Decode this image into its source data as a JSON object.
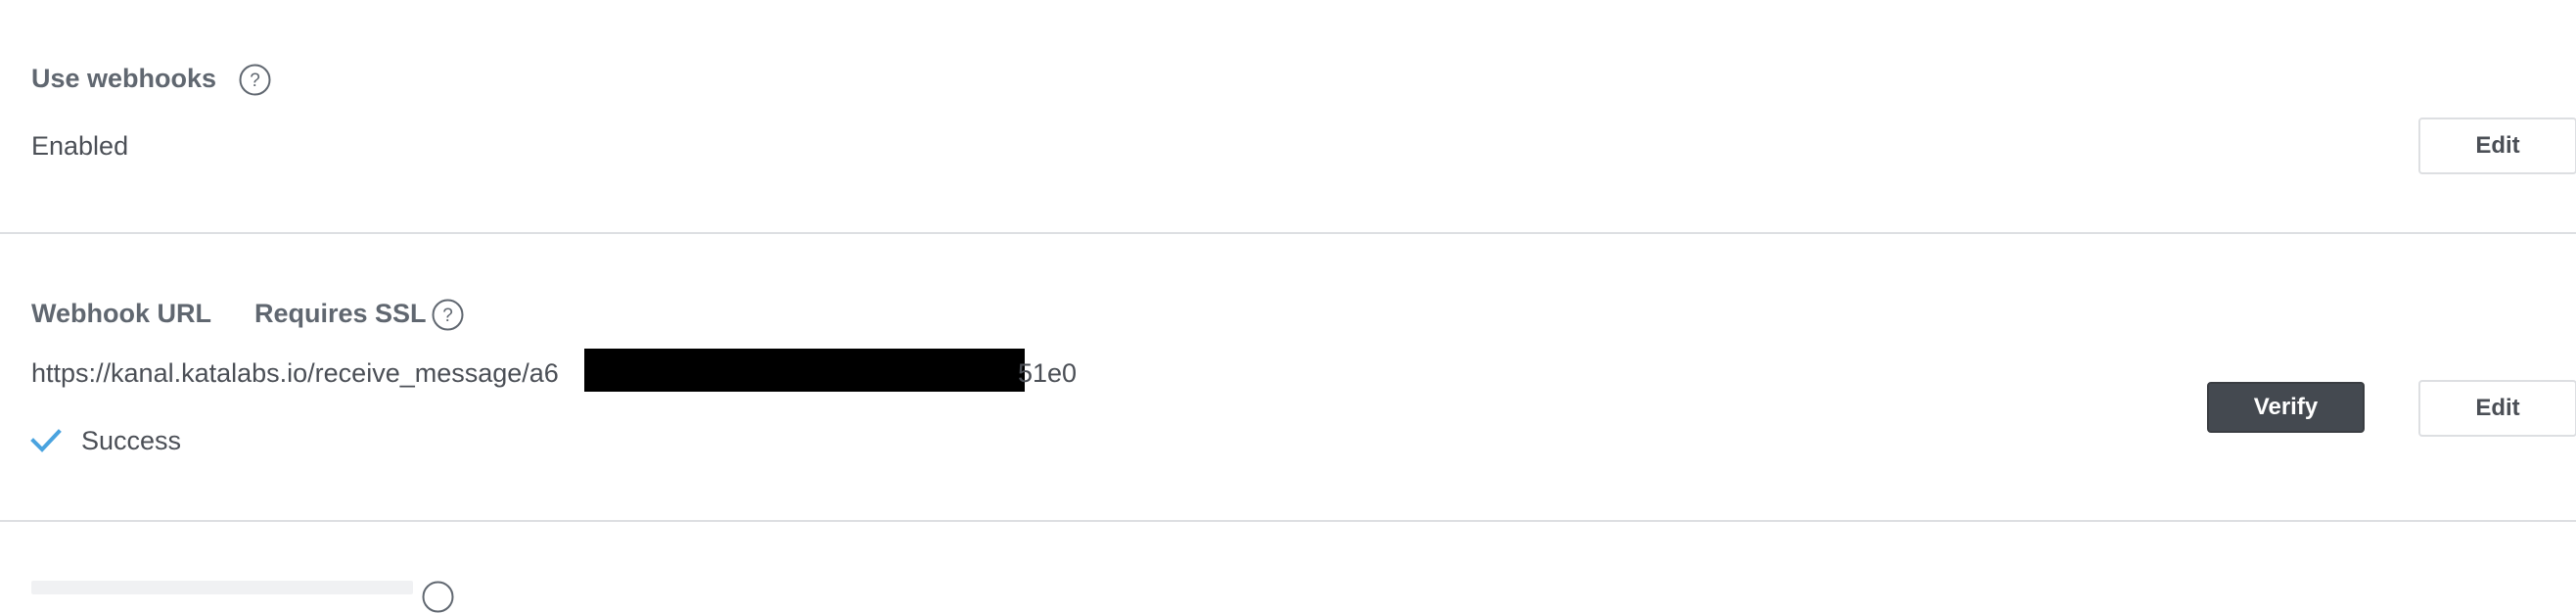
{
  "webhooks_setting": {
    "title": "Use webhooks",
    "help_icon": "question-circle-icon",
    "value": "Enabled",
    "edit_label": "Edit"
  },
  "webhook_url_setting": {
    "title": "Webhook URL",
    "requirement": "Requires SSL",
    "help_icon": "question-circle-icon",
    "url_prefix": "https://kanal.katalabs.io/receive_message/a6",
    "url_suffix": "51e0",
    "status_icon": "checkmark-icon",
    "status": "Success",
    "verify_label": "Verify",
    "edit_label": "Edit"
  },
  "colors": {
    "title": "#606770",
    "text": "#4b4f56",
    "divider": "#dddfe2",
    "verify_bg": "#444950",
    "success_check": "#4aa3df",
    "redaction": "#000000"
  }
}
